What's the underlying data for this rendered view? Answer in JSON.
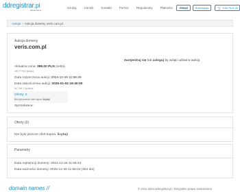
{
  "header": {
    "logo_main": "ddregistrar",
    "logo_tld": ".pl",
    "logo_sub": "domain names",
    "nav": [
      "Szukaj",
      "Cennik",
      "Kontakt",
      "Pomoc",
      "Regulaminy",
      "Płatności",
      "Panel"
    ],
    "login_label": "Zaloguj",
    "register_label": "Rejestracja",
    "cart_label": "0,00 PLN (0)"
  },
  "breadcrumb": {
    "root": "Aukcje",
    "separator": "/",
    "current": "Aukcja domeny veris.com.pl"
  },
  "auction": {
    "domain_label": "Aukcja domeny",
    "domain_name": "veris.com.pl",
    "login_prompt_link1": "Zarejestruj się",
    "login_prompt_mid": " lub ",
    "login_prompt_link2": "zaloguj",
    "login_prompt_tail": " by wziąć udział w aukcji.",
    "price_label": "Aktualna cena: ",
    "price_value": "399,00 PLN",
    "price_suffix": " (netto)",
    "price_gross": "490,77 PLN (brutto)",
    "start_label": "Data rozpoczęcia aukcji: ",
    "start_value": "2024-12-26 11:58:49",
    "end_label": "Data zakończenia aukcji: ",
    "end_value": "2025-01-02 18:40:00",
    "remaining": "za 7 dni i 1 godzinę",
    "offers_label": "Oferty: 0",
    "offers_none": "Nie było jeszcze ofert kupna. ",
    "offers_none_bold": "licytuj!",
    "seller_label": "Sprzedawca:"
  },
  "offers_section": {
    "title": "Oferty (0)",
    "text": "Nie było jeszcze ofert kupna. ",
    "text_bold": "licytuj!"
  },
  "params_section": {
    "title": "Parametry",
    "reg_label": "Data rejestracji domeny: ",
    "reg_value": "2024-12-26 11:58:43",
    "valid_label": "Data ważności domeny: ",
    "valid_value": "2025-12-26 11:58:43 (364 dni)"
  },
  "footer": {
    "logo": "domain names //",
    "copyright": "© 2011-2024 ddregistrar.pl | Wszystkie prawa zastrzeżone"
  },
  "colors": {
    "accent": "#1a8fc7",
    "panel_bg": "#f3f5f7",
    "border": "#e1e4e7"
  }
}
